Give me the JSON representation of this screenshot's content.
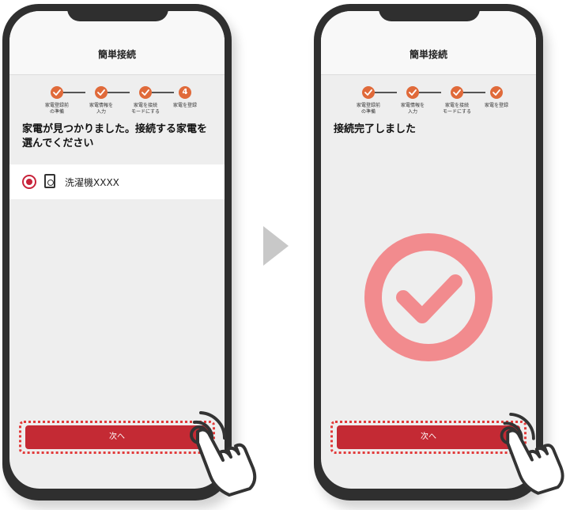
{
  "flow": {
    "arrow_icon": "arrow-right-icon",
    "arrow_color": "#c8c8c8"
  },
  "left_screen": {
    "header_title": "簡単接続",
    "steps": [
      {
        "label": "家電登録前\nの準備",
        "status": "done"
      },
      {
        "label": "家電情報を\n入力",
        "status": "done"
      },
      {
        "label": "家電を接続\nモードにする",
        "status": "done"
      },
      {
        "label": "家電を登録",
        "status": "current",
        "number": "4"
      }
    ],
    "message": "家電が見つかりました。接続する家電を選んでください",
    "device": {
      "name": "洗濯機XXXX",
      "selected": true,
      "icon": "washing-machine-icon"
    },
    "next_button": "次へ"
  },
  "right_screen": {
    "header_title": "簡単接続",
    "steps": [
      {
        "label": "家電登録前\nの準備",
        "status": "done"
      },
      {
        "label": "家電情報を\n入力",
        "status": "done"
      },
      {
        "label": "家電を接続\nモードにする",
        "status": "done"
      },
      {
        "label": "家電を登録",
        "status": "done"
      }
    ],
    "message": "接続完了しました",
    "completion_icon": "check-circle-icon",
    "next_button": "次へ"
  },
  "colors": {
    "accent": "#c42a34",
    "step": "#e06a3a",
    "success_check": "#f28b8e",
    "radio": "#c8233a"
  }
}
